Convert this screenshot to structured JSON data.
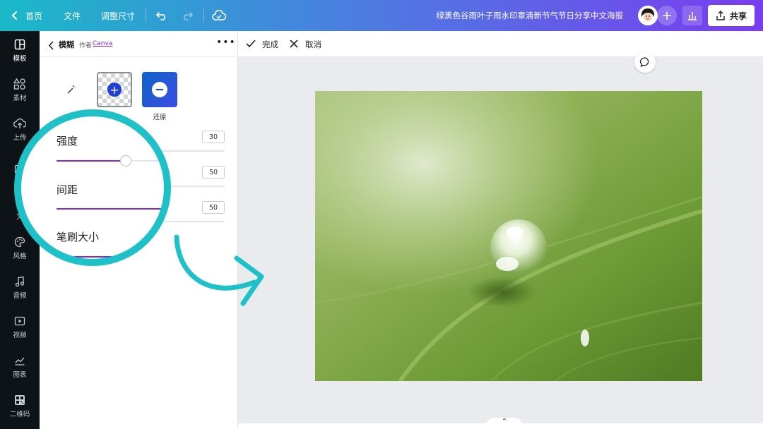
{
  "topbar": {
    "home": "首页",
    "file": "文件",
    "resize": "调整尺寸",
    "title": "绿黑色谷雨叶子雨水印章清新节气节日分享中文海报",
    "share": "共享",
    "icons": [
      "chevron-left-icon",
      "undo-icon",
      "redo-icon",
      "cloud-check-icon",
      "plus-icon",
      "bar-chart-icon",
      "upload-icon"
    ]
  },
  "rail": {
    "items": [
      {
        "label": "模板",
        "icon": "layout-icon"
      },
      {
        "label": "素材",
        "icon": "shapes-icon"
      },
      {
        "label": "上传",
        "icon": "cloud-upload-icon"
      },
      {
        "label": "文",
        "icon": "text-icon"
      },
      {
        "label": "风格",
        "icon": "palette-icon"
      },
      {
        "label": "音频",
        "icon": "music-icon"
      },
      {
        "label": "视频",
        "icon": "video-icon"
      },
      {
        "label": "图表",
        "icon": "chart-icon"
      },
      {
        "label": "二维码",
        "icon": "qrcode-icon"
      }
    ]
  },
  "panel": {
    "title": "模糊",
    "author_prefix": "作者",
    "author_link": "Canva",
    "tools": [
      {
        "label": "",
        "icon": "magic-wand-icon"
      },
      {
        "label": "",
        "icon": "add-blur-icon"
      },
      {
        "label": "还原",
        "icon": "restore-icon"
      }
    ],
    "sliders": [
      {
        "label": "强度",
        "value": "30",
        "fraction": 0.42
      },
      {
        "label": "间距",
        "value": "50",
        "fraction": 0.6
      },
      {
        "label": "笔刷大小",
        "value": "50",
        "fraction": 0.6
      }
    ]
  },
  "canvas_bar": {
    "done": "完成",
    "cancel": "取消"
  },
  "colors": {
    "accent": "#7d2ae8",
    "zoom_ring": "#1fc1c9",
    "rail_bg": "#0e1318",
    "leaf_green": "#6f9a3a"
  }
}
